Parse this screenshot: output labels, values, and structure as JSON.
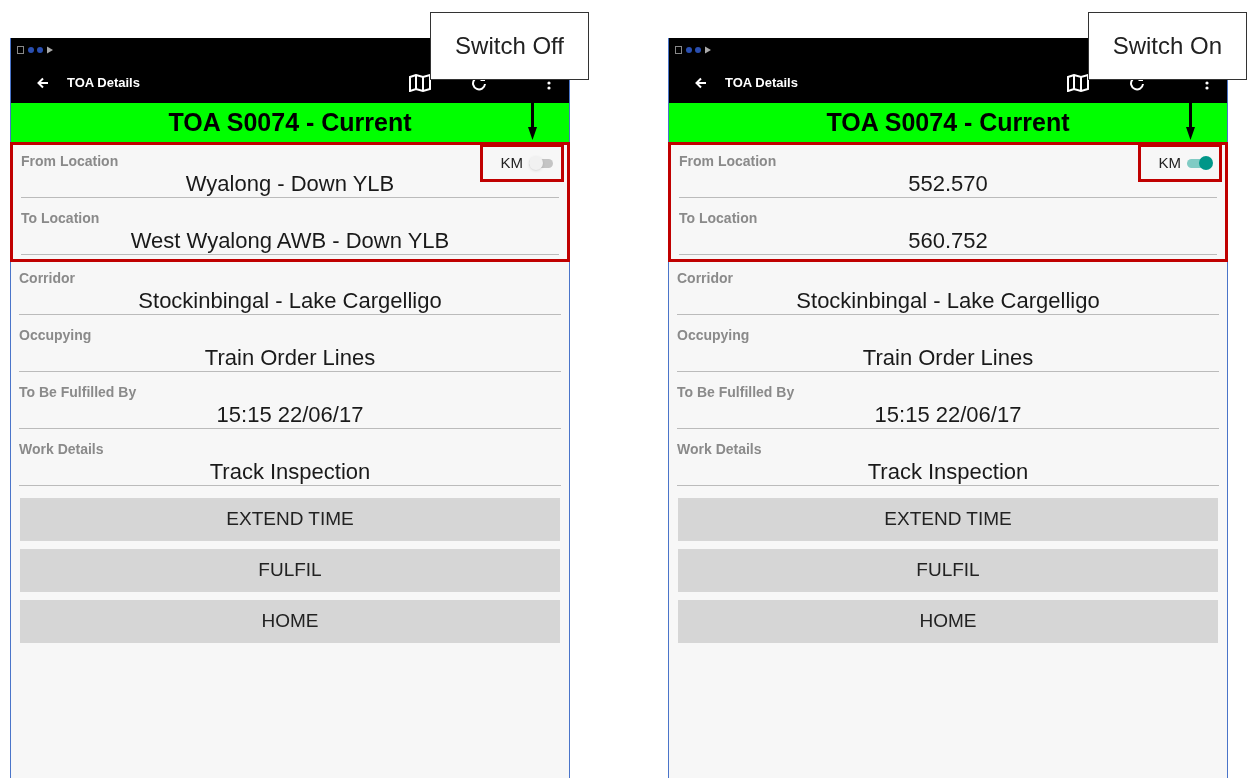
{
  "panels": [
    {
      "callout": "Switch Off",
      "app_bar": {
        "title": "TOA Details"
      },
      "banner": "TOA S0074 - Current",
      "km_switch": {
        "label": "KM",
        "on": false,
        "highlighted": true
      },
      "fields": [
        {
          "label": "From Location",
          "value": "Wyalong - Down YLB",
          "highlighted": true
        },
        {
          "label": "To Location",
          "value": "West Wyalong AWB - Down YLB",
          "highlighted": true
        },
        {
          "label": "Corridor",
          "value": "Stockinbingal - Lake Cargelligo",
          "highlighted": false
        },
        {
          "label": "Occupying",
          "value": "Train Order Lines",
          "highlighted": false
        },
        {
          "label": "To Be Fulfilled By",
          "value": "15:15 22/06/17",
          "highlighted": false
        },
        {
          "label": "Work Details",
          "value": "Track Inspection",
          "highlighted": false
        }
      ],
      "buttons": [
        "EXTEND TIME",
        "FULFIL",
        "HOME"
      ]
    },
    {
      "callout": "Switch On",
      "app_bar": {
        "title": "TOA Details"
      },
      "banner": "TOA S0074 - Current",
      "km_switch": {
        "label": "KM",
        "on": true,
        "highlighted": true
      },
      "fields": [
        {
          "label": "From Location",
          "value": "552.570",
          "highlighted": true
        },
        {
          "label": "To Location",
          "value": "560.752",
          "highlighted": true
        },
        {
          "label": "Corridor",
          "value": "Stockinbingal - Lake Cargelligo",
          "highlighted": false
        },
        {
          "label": "Occupying",
          "value": "Train Order Lines",
          "highlighted": false
        },
        {
          "label": "To Be Fulfilled By",
          "value": "15:15 22/06/17",
          "highlighted": false
        },
        {
          "label": "Work Details",
          "value": "Track Inspection",
          "highlighted": false
        }
      ],
      "buttons": [
        "EXTEND TIME",
        "FULFIL",
        "HOME"
      ]
    }
  ]
}
